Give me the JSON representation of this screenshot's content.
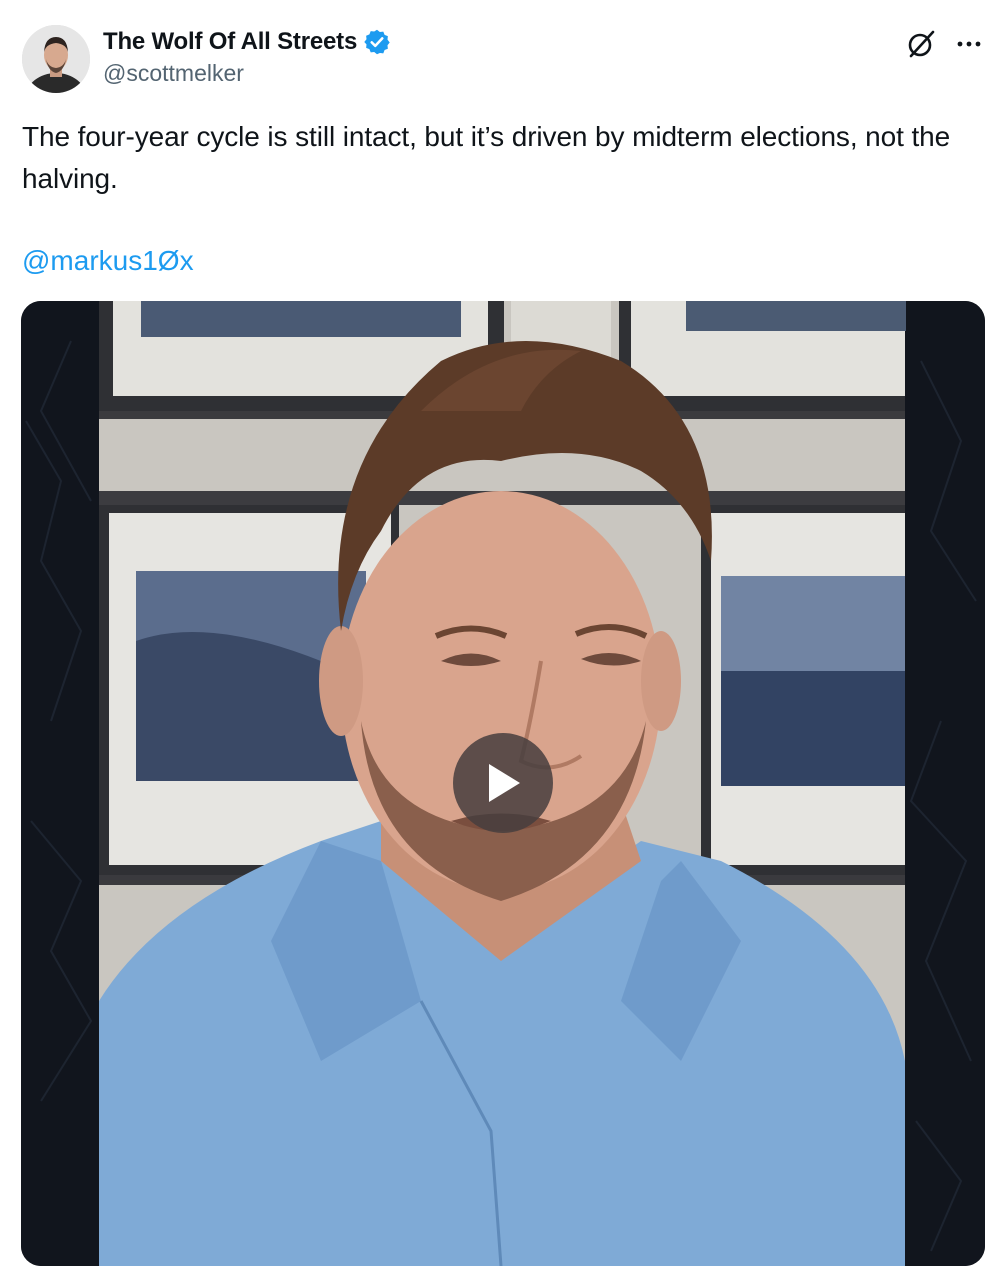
{
  "author": {
    "name": "The Wolf Of All Streets",
    "handle": "@scottmelker",
    "verified": true
  },
  "tweet": {
    "text": "The four-year cycle is still intact, but it’s driven by midterm elections, not the halving.",
    "mention": "@markus1Øx"
  },
  "icons": {
    "grok": "grok-icon",
    "more": "more-options-icon",
    "play": "play-icon",
    "verified": "verified-badge-icon"
  },
  "colors": {
    "link": "#1d9bf0",
    "verified": "#1d9bf0",
    "secondary_text": "#536471"
  }
}
